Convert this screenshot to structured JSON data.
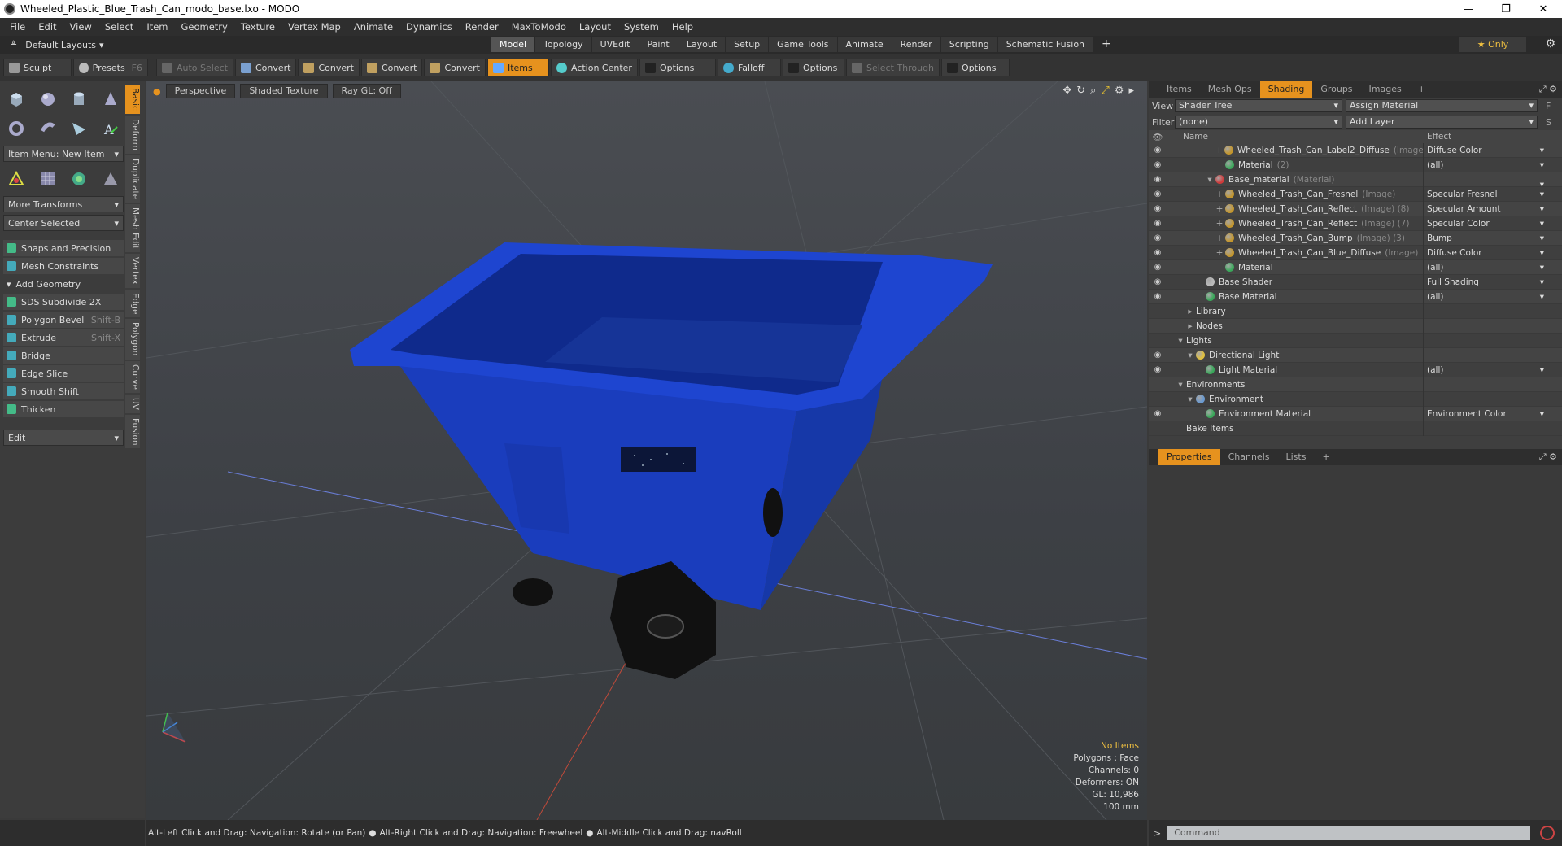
{
  "window": {
    "title": "Wheeled_Plastic_Blue_Trash_Can_modo_base.lxo - MODO",
    "controls": [
      "—",
      "❐",
      "✕"
    ]
  },
  "menu": [
    "File",
    "Edit",
    "View",
    "Select",
    "Item",
    "Geometry",
    "Texture",
    "Vertex Map",
    "Animate",
    "Dynamics",
    "Render",
    "MaxToModo",
    "Layout",
    "System",
    "Help"
  ],
  "layout_selector": "Default Layouts",
  "layout_tabs": [
    {
      "label": "Model",
      "active": true
    },
    {
      "label": "Topology"
    },
    {
      "label": "UVEdit"
    },
    {
      "label": "Paint"
    },
    {
      "label": "Layout"
    },
    {
      "label": "Setup"
    },
    {
      "label": "Game Tools"
    },
    {
      "label": "Animate"
    },
    {
      "label": "Render"
    },
    {
      "label": "Scripting"
    },
    {
      "label": "Schematic Fusion"
    }
  ],
  "layout_plus": "+",
  "only_label": "Only",
  "toolbar": {
    "sculpt": "Sculpt",
    "presets": "Presets",
    "presets_key": "F6",
    "auto_select": "Auto Select",
    "convert": "Convert",
    "items": "Items",
    "action_center": "Action Center",
    "options": "Options",
    "falloff": "Falloff",
    "select_through": "Select Through"
  },
  "left_panel": {
    "item_menu": "Item Menu: New Item",
    "more_transforms": "More Transforms",
    "center_selected": "Center Selected",
    "snaps": "Snaps and Precision",
    "mesh_constraints": "Mesh Constraints",
    "add_geometry": "Add Geometry",
    "tools": [
      {
        "label": "SDS Subdivide 2X",
        "key": ""
      },
      {
        "label": "Polygon Bevel",
        "key": "Shift-B"
      },
      {
        "label": "Extrude",
        "key": "Shift-X"
      },
      {
        "label": "Bridge",
        "key": ""
      },
      {
        "label": "Edge Slice",
        "key": ""
      },
      {
        "label": "Smooth Shift",
        "key": ""
      },
      {
        "label": "Thicken",
        "key": ""
      }
    ],
    "edit": "Edit",
    "vtabs": [
      "Basic",
      "Deform",
      "Duplicate",
      "Mesh Edit",
      "Vertex",
      "Edge",
      "Polygon",
      "Curve",
      "UV",
      "Fusion"
    ]
  },
  "viewport": {
    "perspective": "Perspective",
    "shading": "Shaded Texture",
    "raygl": "Ray GL: Off",
    "info": {
      "items": "No Items",
      "polygons": "Polygons : Face",
      "channels": "Channels: 0",
      "deformers": "Deformers: ON",
      "gl": "GL: 10,986",
      "unit": "100 mm"
    },
    "colors": {
      "bin": "#1a3dbd",
      "bin_dark": "#0f2a8c",
      "bin_rim": "#1e45d0",
      "wheel": "#111111"
    }
  },
  "status": {
    "hint1": "Alt-Left Click and Drag: Navigation: Rotate (or Pan)",
    "hint2": "Alt-Right Click and Drag: Navigation: Freewheel",
    "hint3": "Alt-Middle Click and Drag: navRoll",
    "dot": "●"
  },
  "right_panel": {
    "tabs": [
      {
        "label": "Items"
      },
      {
        "label": "Mesh Ops"
      },
      {
        "label": "Shading",
        "active": true
      },
      {
        "label": "Groups"
      },
      {
        "label": "Images"
      }
    ],
    "view_label": "View",
    "view_value": "Shader Tree",
    "assign": "Assign Material",
    "assign_key": "F",
    "filter_label": "Filter",
    "filter_value": "(none)",
    "add_layer": "Add Layer",
    "add_layer_key": "S",
    "col_name": "Name",
    "col_effect": "Effect",
    "rows": [
      {
        "eye": true,
        "indent": 5,
        "tg": "+",
        "ball": "#c4962c",
        "name": "Wheeled_Trash_Can_Label2_Diffuse",
        "sub": "(Image)",
        "effect": "Diffuse Color",
        "dd": true
      },
      {
        "eye": true,
        "indent": 5,
        "tg": "",
        "ball": "#3aa85a",
        "name": "Material",
        "sub": "(2)",
        "effect": "(all)",
        "dd": true
      },
      {
        "eye": true,
        "indent": 4,
        "tg": "▾",
        "ball": "#d03a3a",
        "name": "Base_material",
        "sub": "(Material)",
        "effect": "",
        "dd": true
      },
      {
        "eye": true,
        "indent": 5,
        "tg": "+",
        "ball": "#c4962c",
        "name": "Wheeled_Trash_Can_Fresnel",
        "sub": "(Image)",
        "effect": "Specular Fresnel",
        "dd": true
      },
      {
        "eye": true,
        "indent": 5,
        "tg": "+",
        "ball": "#c4962c",
        "name": "Wheeled_Trash_Can_Reflect",
        "sub": "(Image) (8)",
        "effect": "Specular Amount",
        "dd": true
      },
      {
        "eye": true,
        "indent": 5,
        "tg": "+",
        "ball": "#c4962c",
        "name": "Wheeled_Trash_Can_Reflect",
        "sub": "(Image) (7)",
        "effect": "Specular Color",
        "dd": true
      },
      {
        "eye": true,
        "indent": 5,
        "tg": "+",
        "ball": "#c4962c",
        "name": "Wheeled_Trash_Can_Bump",
        "sub": "(Image) (3)",
        "effect": "Bump",
        "dd": true
      },
      {
        "eye": true,
        "indent": 5,
        "tg": "+",
        "ball": "#c4962c",
        "name": "Wheeled_Trash_Can_Blue_Diffuse",
        "sub": "(Image)",
        "effect": "Diffuse Color",
        "dd": true
      },
      {
        "eye": true,
        "indent": 5,
        "tg": "",
        "ball": "#3aa85a",
        "name": "Material",
        "sub": "",
        "effect": "(all)",
        "dd": true
      },
      {
        "eye": true,
        "indent": 3,
        "tg": "",
        "ball": "#bbbbbb",
        "name": "Base Shader",
        "sub": "",
        "effect": "Full Shading",
        "dd": true
      },
      {
        "eye": true,
        "indent": 3,
        "tg": "",
        "ball": "#3aa85a",
        "name": "Base Material",
        "sub": "",
        "effect": "(all)",
        "dd": true
      },
      {
        "eye": false,
        "indent": 2,
        "tg": "▸",
        "ball": "",
        "name": "Library",
        "sub": "",
        "effect": "",
        "dd": false
      },
      {
        "eye": false,
        "indent": 2,
        "tg": "▸",
        "ball": "",
        "name": "Nodes",
        "sub": "",
        "effect": "",
        "dd": false
      },
      {
        "eye": false,
        "indent": 1,
        "tg": "▾",
        "ball": "",
        "name": "Lights",
        "sub": "",
        "effect": "",
        "dd": false
      },
      {
        "eye": true,
        "indent": 2,
        "tg": "▾",
        "ball": "#e0c040",
        "name": "Directional Light",
        "sub": "",
        "effect": "",
        "dd": false
      },
      {
        "eye": true,
        "indent": 3,
        "tg": "",
        "ball": "#3aa85a",
        "name": "Light Material",
        "sub": "",
        "effect": "(all)",
        "dd": true
      },
      {
        "eye": false,
        "indent": 1,
        "tg": "▾",
        "ball": "",
        "name": "Environments",
        "sub": "",
        "effect": "",
        "dd": false
      },
      {
        "eye": false,
        "indent": 2,
        "tg": "▾",
        "ball": "#6a9ad0",
        "name": "Environment",
        "sub": "",
        "effect": "",
        "dd": false
      },
      {
        "eye": true,
        "indent": 3,
        "tg": "",
        "ball": "#3aa85a",
        "name": "Environment Material",
        "sub": "",
        "effect": "Environment Color",
        "dd": true
      },
      {
        "eye": false,
        "indent": 1,
        "tg": "",
        "ball": "",
        "name": "Bake Items",
        "sub": "",
        "effect": "",
        "dd": false
      }
    ],
    "prop_tabs": [
      {
        "label": "Properties",
        "active": true
      },
      {
        "label": "Channels"
      },
      {
        "label": "Lists"
      }
    ],
    "command_placeholder": "Command"
  }
}
